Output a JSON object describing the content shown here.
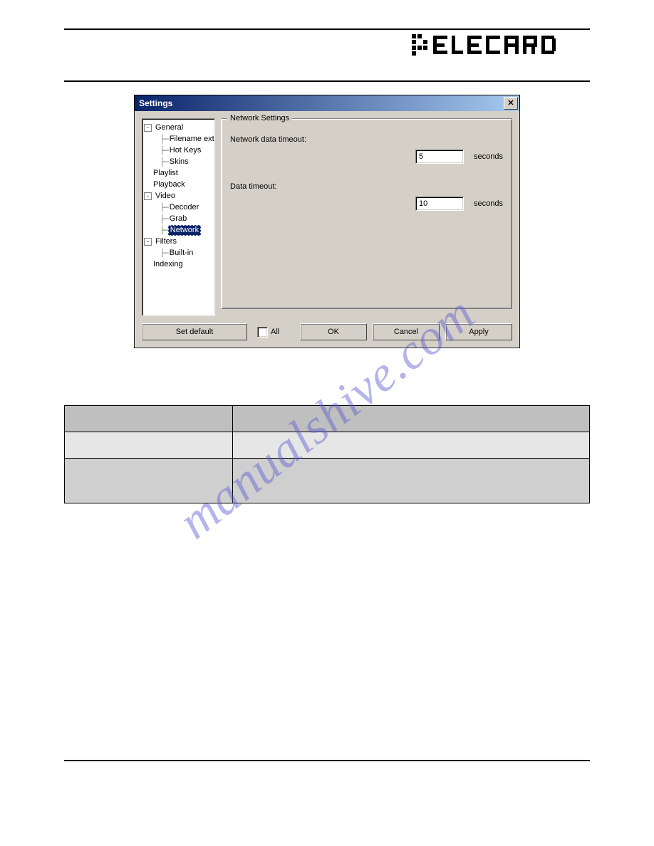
{
  "logo_text": "elecard",
  "watermark": "manualshive.com",
  "dialog": {
    "title": "Settings",
    "close_glyph": "✕",
    "tree": [
      {
        "indent": 0,
        "pm": "-",
        "label": "General"
      },
      {
        "indent": 1,
        "pm": "",
        "label": "Filename extension"
      },
      {
        "indent": 1,
        "pm": "",
        "label": "Hot Keys"
      },
      {
        "indent": 1,
        "pm": "",
        "label": "Skins"
      },
      {
        "indent": 0,
        "pm": "",
        "label": "Playlist"
      },
      {
        "indent": 0,
        "pm": "",
        "label": "Playback"
      },
      {
        "indent": 0,
        "pm": "-",
        "label": "Video"
      },
      {
        "indent": 1,
        "pm": "",
        "label": "Decoder"
      },
      {
        "indent": 1,
        "pm": "",
        "label": "Grab"
      },
      {
        "indent": 1,
        "pm": "",
        "label": "Network",
        "selected": true
      },
      {
        "indent": 0,
        "pm": "-",
        "label": "Filters"
      },
      {
        "indent": 1,
        "pm": "",
        "label": "Built-in"
      },
      {
        "indent": 0,
        "pm": "",
        "label": "Indexing"
      }
    ],
    "group_legend": "Network Settings",
    "field1_label": "Network data timeout:",
    "field1_value": "5",
    "field1_unit": "seconds",
    "field2_label": "Data timeout:",
    "field2_value": "10",
    "field2_unit": "seconds",
    "set_default": "Set default",
    "all_label": "All",
    "ok": "OK",
    "cancel": "Cancel",
    "apply": "Apply"
  },
  "table": {
    "header_left": "",
    "header_right": "",
    "row1_left": "",
    "row1_right": "",
    "row2_left": "",
    "row2_right": ""
  }
}
